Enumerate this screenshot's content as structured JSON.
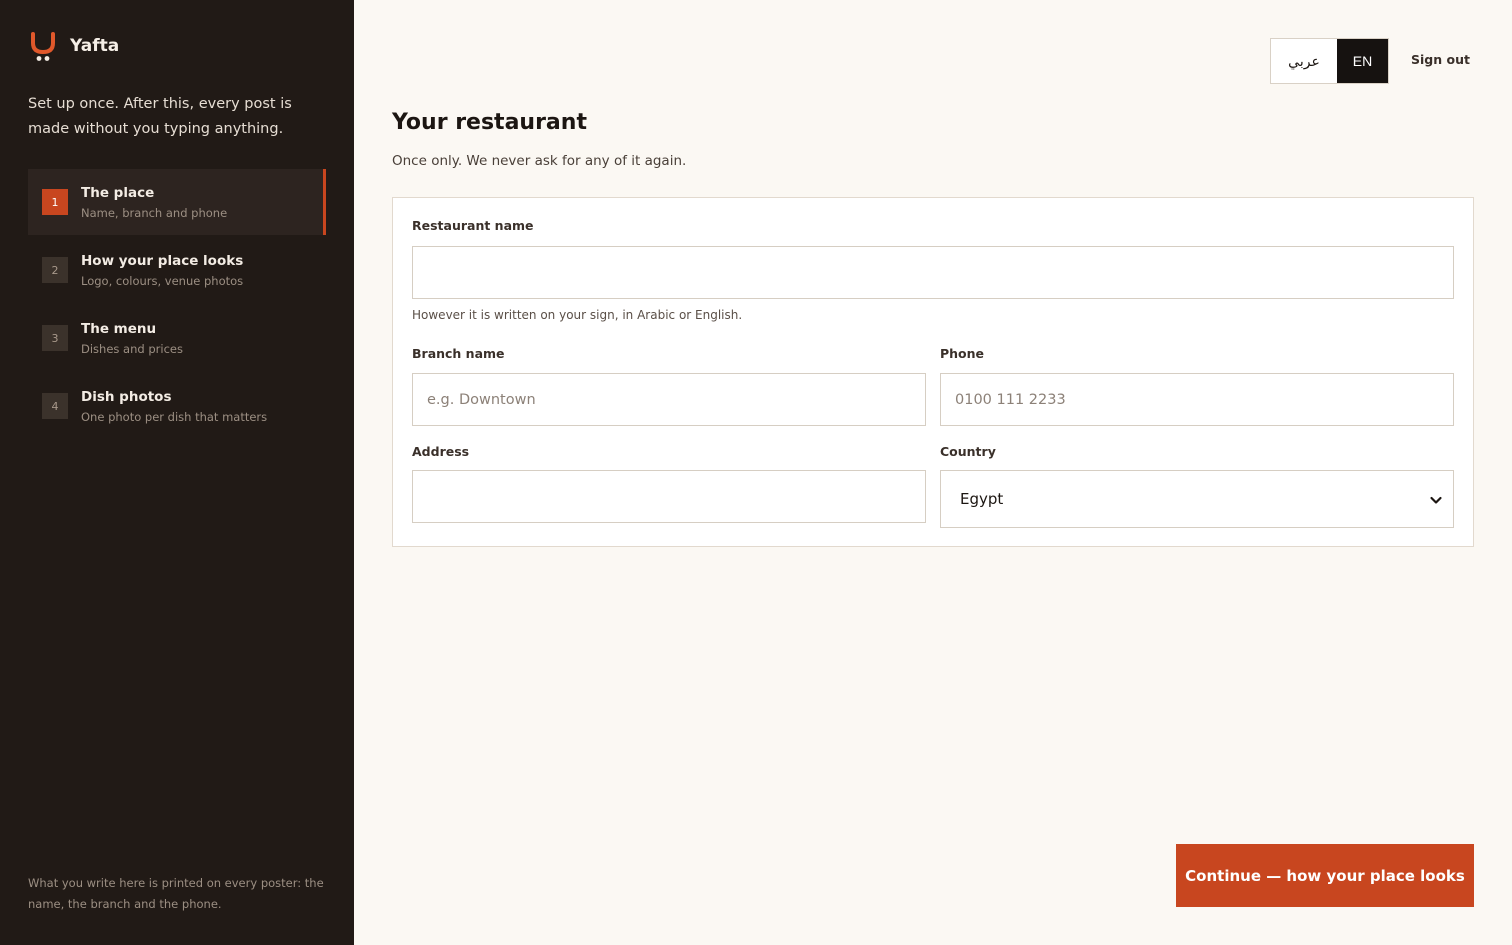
{
  "brand": {
    "name": "Yafta",
    "accent": "#c8461f"
  },
  "sidebar": {
    "tagline": "Set up once. After this, every post is made without you typing anything.",
    "steps": [
      {
        "num": "1",
        "title": "The place",
        "sub": "Name, branch and phone",
        "active": true
      },
      {
        "num": "2",
        "title": "How your place looks",
        "sub": "Logo, colours, venue photos",
        "active": false
      },
      {
        "num": "3",
        "title": "The menu",
        "sub": "Dishes and prices",
        "active": false
      },
      {
        "num": "4",
        "title": "Dish photos",
        "sub": "One photo per dish that matters",
        "active": false
      }
    ],
    "note": "What you write here is printed on every poster: the name, the branch and the phone."
  },
  "header": {
    "lang_arabic": "عربي",
    "lang_english": "EN",
    "sign_out": "Sign out"
  },
  "main": {
    "title": "Your restaurant",
    "subtitle": "Once only. We never ask for any of it again.",
    "form": {
      "restaurant_name_label": "Restaurant name",
      "restaurant_name_value": "",
      "restaurant_name_hint": "However it is written on your sign, in Arabic or English.",
      "branch_label": "Branch name",
      "branch_placeholder": "e.g. Downtown",
      "phone_label": "Phone",
      "phone_placeholder": "0100 111 2233",
      "address_label": "Address",
      "address_value": "",
      "country_label": "Country",
      "country_value": "Egypt"
    },
    "continue_label": "Continue — how your place looks"
  }
}
